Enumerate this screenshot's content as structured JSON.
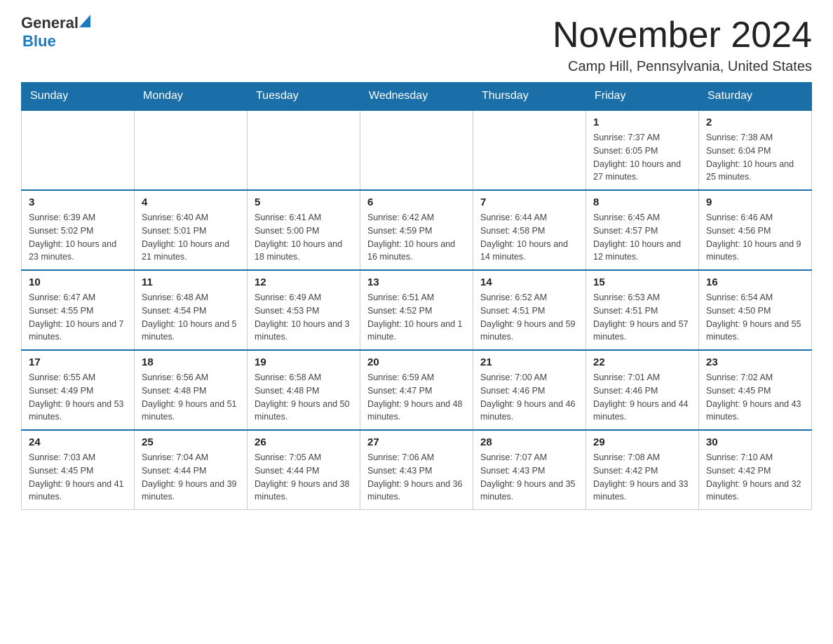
{
  "header": {
    "title": "November 2024",
    "subtitle": "Camp Hill, Pennsylvania, United States",
    "logo_line1": "General",
    "logo_line2": "Blue"
  },
  "days_of_week": [
    "Sunday",
    "Monday",
    "Tuesday",
    "Wednesday",
    "Thursday",
    "Friday",
    "Saturday"
  ],
  "weeks": [
    {
      "days": [
        {
          "number": "",
          "info": ""
        },
        {
          "number": "",
          "info": ""
        },
        {
          "number": "",
          "info": ""
        },
        {
          "number": "",
          "info": ""
        },
        {
          "number": "",
          "info": ""
        },
        {
          "number": "1",
          "info": "Sunrise: 7:37 AM\nSunset: 6:05 PM\nDaylight: 10 hours and 27 minutes."
        },
        {
          "number": "2",
          "info": "Sunrise: 7:38 AM\nSunset: 6:04 PM\nDaylight: 10 hours and 25 minutes."
        }
      ]
    },
    {
      "days": [
        {
          "number": "3",
          "info": "Sunrise: 6:39 AM\nSunset: 5:02 PM\nDaylight: 10 hours and 23 minutes."
        },
        {
          "number": "4",
          "info": "Sunrise: 6:40 AM\nSunset: 5:01 PM\nDaylight: 10 hours and 21 minutes."
        },
        {
          "number": "5",
          "info": "Sunrise: 6:41 AM\nSunset: 5:00 PM\nDaylight: 10 hours and 18 minutes."
        },
        {
          "number": "6",
          "info": "Sunrise: 6:42 AM\nSunset: 4:59 PM\nDaylight: 10 hours and 16 minutes."
        },
        {
          "number": "7",
          "info": "Sunrise: 6:44 AM\nSunset: 4:58 PM\nDaylight: 10 hours and 14 minutes."
        },
        {
          "number": "8",
          "info": "Sunrise: 6:45 AM\nSunset: 4:57 PM\nDaylight: 10 hours and 12 minutes."
        },
        {
          "number": "9",
          "info": "Sunrise: 6:46 AM\nSunset: 4:56 PM\nDaylight: 10 hours and 9 minutes."
        }
      ]
    },
    {
      "days": [
        {
          "number": "10",
          "info": "Sunrise: 6:47 AM\nSunset: 4:55 PM\nDaylight: 10 hours and 7 minutes."
        },
        {
          "number": "11",
          "info": "Sunrise: 6:48 AM\nSunset: 4:54 PM\nDaylight: 10 hours and 5 minutes."
        },
        {
          "number": "12",
          "info": "Sunrise: 6:49 AM\nSunset: 4:53 PM\nDaylight: 10 hours and 3 minutes."
        },
        {
          "number": "13",
          "info": "Sunrise: 6:51 AM\nSunset: 4:52 PM\nDaylight: 10 hours and 1 minute."
        },
        {
          "number": "14",
          "info": "Sunrise: 6:52 AM\nSunset: 4:51 PM\nDaylight: 9 hours and 59 minutes."
        },
        {
          "number": "15",
          "info": "Sunrise: 6:53 AM\nSunset: 4:51 PM\nDaylight: 9 hours and 57 minutes."
        },
        {
          "number": "16",
          "info": "Sunrise: 6:54 AM\nSunset: 4:50 PM\nDaylight: 9 hours and 55 minutes."
        }
      ]
    },
    {
      "days": [
        {
          "number": "17",
          "info": "Sunrise: 6:55 AM\nSunset: 4:49 PM\nDaylight: 9 hours and 53 minutes."
        },
        {
          "number": "18",
          "info": "Sunrise: 6:56 AM\nSunset: 4:48 PM\nDaylight: 9 hours and 51 minutes."
        },
        {
          "number": "19",
          "info": "Sunrise: 6:58 AM\nSunset: 4:48 PM\nDaylight: 9 hours and 50 minutes."
        },
        {
          "number": "20",
          "info": "Sunrise: 6:59 AM\nSunset: 4:47 PM\nDaylight: 9 hours and 48 minutes."
        },
        {
          "number": "21",
          "info": "Sunrise: 7:00 AM\nSunset: 4:46 PM\nDaylight: 9 hours and 46 minutes."
        },
        {
          "number": "22",
          "info": "Sunrise: 7:01 AM\nSunset: 4:46 PM\nDaylight: 9 hours and 44 minutes."
        },
        {
          "number": "23",
          "info": "Sunrise: 7:02 AM\nSunset: 4:45 PM\nDaylight: 9 hours and 43 minutes."
        }
      ]
    },
    {
      "days": [
        {
          "number": "24",
          "info": "Sunrise: 7:03 AM\nSunset: 4:45 PM\nDaylight: 9 hours and 41 minutes."
        },
        {
          "number": "25",
          "info": "Sunrise: 7:04 AM\nSunset: 4:44 PM\nDaylight: 9 hours and 39 minutes."
        },
        {
          "number": "26",
          "info": "Sunrise: 7:05 AM\nSunset: 4:44 PM\nDaylight: 9 hours and 38 minutes."
        },
        {
          "number": "27",
          "info": "Sunrise: 7:06 AM\nSunset: 4:43 PM\nDaylight: 9 hours and 36 minutes."
        },
        {
          "number": "28",
          "info": "Sunrise: 7:07 AM\nSunset: 4:43 PM\nDaylight: 9 hours and 35 minutes."
        },
        {
          "number": "29",
          "info": "Sunrise: 7:08 AM\nSunset: 4:42 PM\nDaylight: 9 hours and 33 minutes."
        },
        {
          "number": "30",
          "info": "Sunrise: 7:10 AM\nSunset: 4:42 PM\nDaylight: 9 hours and 32 minutes."
        }
      ]
    }
  ]
}
